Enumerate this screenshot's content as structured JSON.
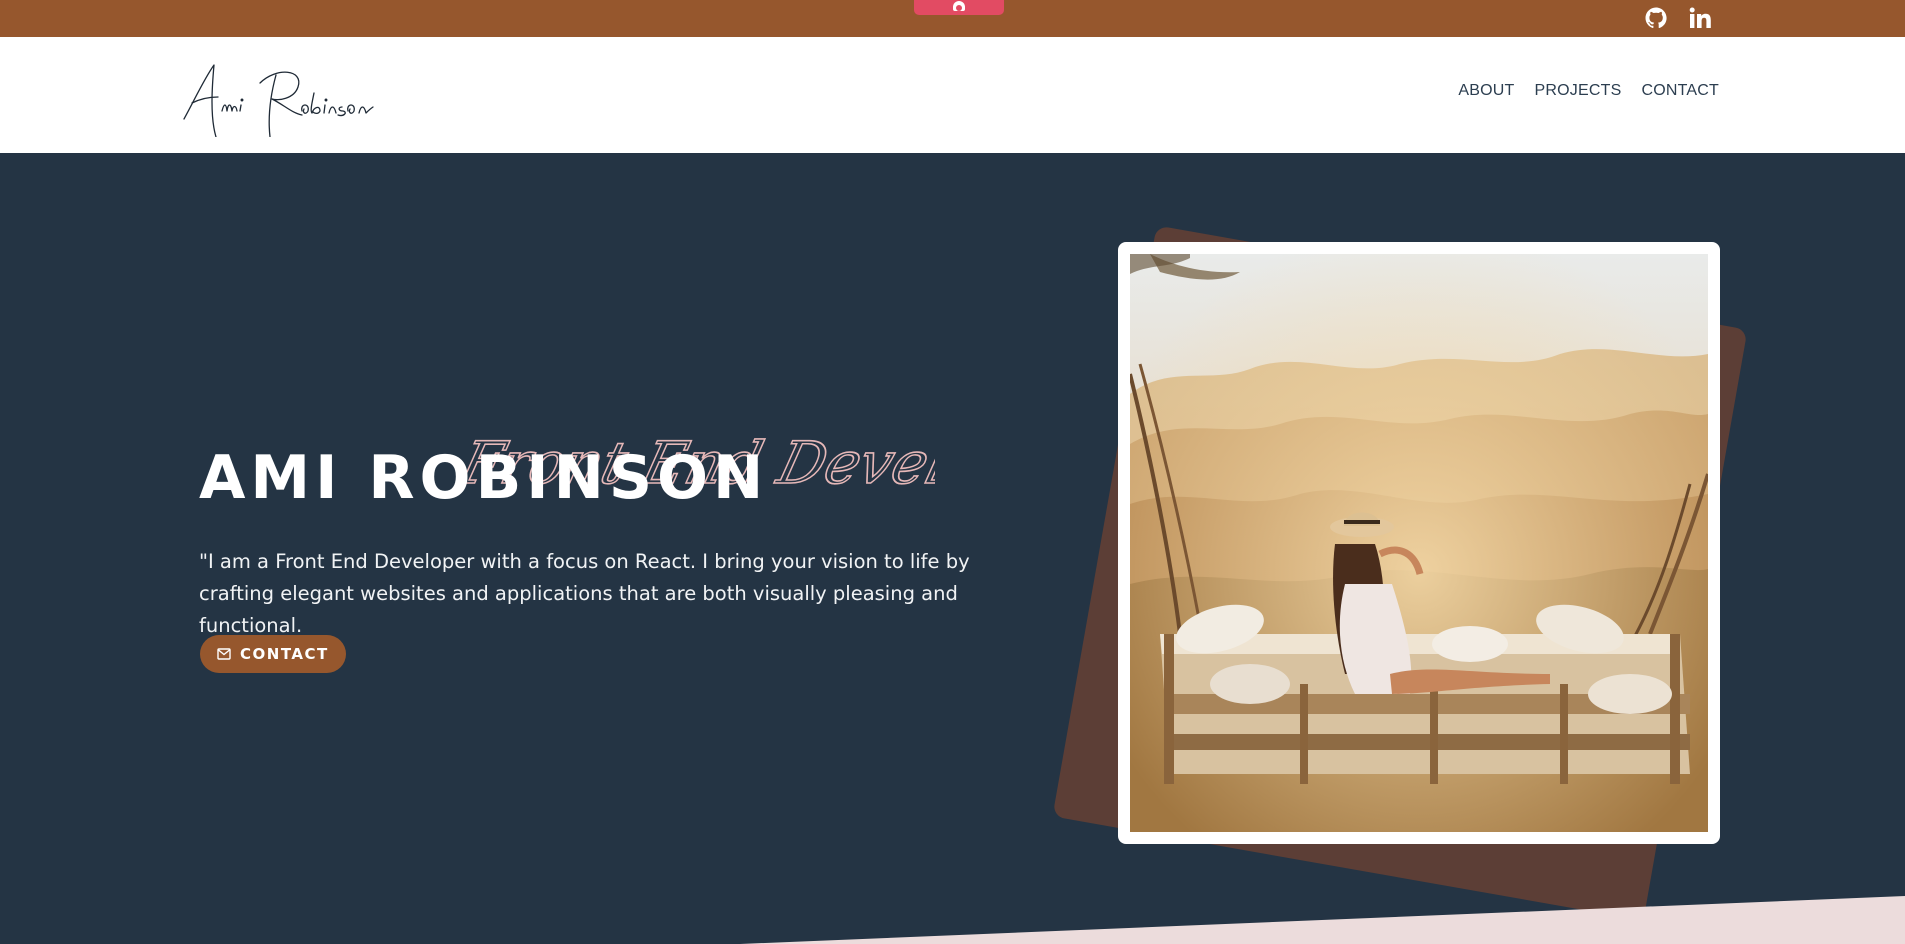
{
  "topbar": {
    "accent_color": "#96572d",
    "pill_color": "#e24b63",
    "social": [
      {
        "name": "GitHub",
        "icon": "github-icon"
      },
      {
        "name": "LinkedIn",
        "icon": "linkedin-icon"
      }
    ]
  },
  "header": {
    "logo_text": "Ami Robinson",
    "nav": [
      {
        "label": "ABOUT"
      },
      {
        "label": "PROJECTS"
      },
      {
        "label": "CONTACT"
      }
    ]
  },
  "hero": {
    "script_title": "Front End Developer",
    "name": "AMI ROBINSON",
    "intro": "\"I am a Front End Developer with a focus on React. I bring your vision to life by crafting elegant websites and applications that are both visually pleasing and functional.",
    "cta_label": "CONTACT",
    "cta_icon": "mail-icon",
    "background_color": "#243444",
    "photo_alt": "Woman in sun hat sitting on a hanging swing bed overlooking a jungle"
  }
}
